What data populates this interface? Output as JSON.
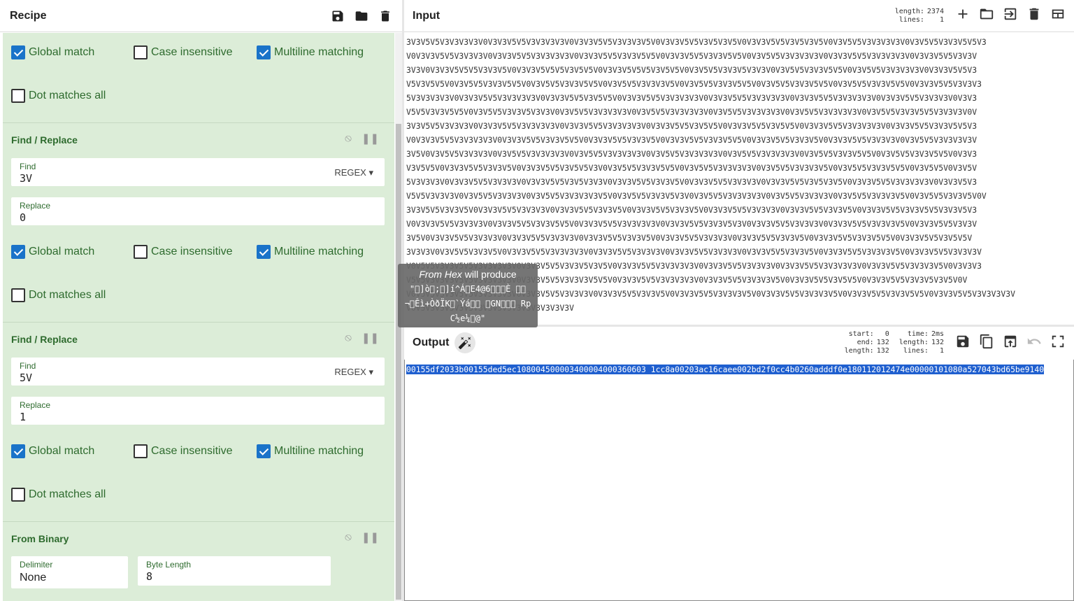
{
  "recipe": {
    "title": "Recipe",
    "header_icons": [
      "save-icon",
      "folder-icon",
      "trash-icon"
    ],
    "top_options": {
      "global_match": "Global match",
      "case_insensitive": "Case insensitive",
      "multiline": "Multiline matching",
      "dot_all": "Dot matches all"
    },
    "ops": [
      {
        "title": "Find / Replace",
        "find_label": "Find",
        "find_value": "3V",
        "find_mode": "REGEX",
        "replace_label": "Replace",
        "replace_value": "0",
        "global_match": "Global match",
        "case_insensitive": "Case insensitive",
        "multiline": "Multiline matching",
        "dot_all": "Dot matches all"
      },
      {
        "title": "Find / Replace",
        "find_label": "Find",
        "find_value": "5V",
        "find_mode": "REGEX",
        "replace_label": "Replace",
        "replace_value": "1",
        "global_match": "Global match",
        "case_insensitive": "Case insensitive",
        "multiline": "Multiline matching",
        "dot_all": "Dot matches all"
      },
      {
        "title": "From Binary",
        "delimiter_label": "Delimiter",
        "delimiter_value": "None",
        "byte_length_label": "Byte Length",
        "byte_length_value": "8"
      }
    ]
  },
  "input": {
    "title": "Input",
    "stats": {
      "length_label": "length:",
      "length": "2374",
      "lines_label": "lines:",
      "lines": "1"
    },
    "lines": [
      "3V3V5V5V3V3V3V3V0V3V3V5V5V3V3V3V3V0V3V3V5V5V3V3V3V5V0V3V3V5V5V3V5V3V5V0V3V3V5V5V3V5V3V5V0V3V5V5V3V3V3V3V0V3V5V5V3V3V5V5V3",
      "V0V3V3V5V5V3V3V3V0V3V3V5V5V3V3V3V3V0V3V3V5V5V3V3V5V5V0V3V3V5V5V3V3V5V5V0V3V5V5V3V3V3V3V0V3V3V5V5V3V3V3V3V0V3V3V5V5V3V3V",
      "3V3V0V3V3V5V5V5V3V3V5V0V3V3V5V5V5V3V5V5V0V3V3V5V5V5V3V5V5V0V3V5V5V3V3V5V3V3V0V3V5V5V3V3V5V5V0V3V5V5V3V3V3V3V0V3V3V5V5V3",
      "V5V3V5V5V0V3V5V5V3V3V5V5V0V3V5V5V3V3V5V5V0V3V5V5V3V3V3V5V0V3V5V5V3V3V5V5V0V3V5V5V3V3V5V5V0V3V5V5V3V3V5V5V0V3V3V5V5V3V3V3",
      "5V3V3V3V3V0V3V3V5V5V3V3V3V3V0V3V3V5V5V3V5V5V0V3V3V5V5V3V3V3V3V0V3V3V5V5V3V3V3V3V0V3V3V5V5V3V3V3V3V0V3V3V5V5V3V3V3V0V3V3",
      "V5V5V3V3V5V5V0V3V5V5V3V3V5V3V3V0V3V5V5V3V3V3V3V0V3V5V5V3V3V3V3V0V3V5V5V3V3V3V3V0V3V5V5V3V3V3V3V0V3V5V5V3V3V5V5V3V3V3V0V",
      "3V3V5V5V3V3V3V0V3V3V5V5V3V3V3V3V0V3V3V5V5V3V3V3V3V0V3V3V5V5V3V5V5V0V3V3V5V5V3V5V5V0V3V3V5V5V3V3V3V3V0V3V3V5V5V3V3V5V5V3",
      "V0V3V3V5V5V3V3V3V3V0V3V3V5V5V3V3V5V5V0V3V3V5V5V3V3V5V0V3V3V5V5V3V3V5V5V0V3V3V5V5V3V3V5V0V3V3V5V5V3V3V3V0V3V5V5V3V3V3V3V",
      "3V5V0V3V5V5V3V3V3V0V3V5V5V3V3V3V3V0V3V5V5V3V3V3V3V0V3V5V5V3V3V3V3V0V3V5V5V3V3V3V3V0V3V5V5V3V3V5V5V0V3V5V5V3V3V5V5V0V3V3",
      "V3V5V5V0V3V3V5V5V3V3V5V0V3V3V5V5V3V5V5V3V0V3V5V5V3V3V5V5V0V3V5V5V3V3V3V3V0V3V5V5V3V3V3V5V0V3V5V5V3V3V5V5V0V3V5V5V0V3V5V",
      "5V3V3V3V0V3V3V5V5V3V3V3V0V3V3V5V5V3V5V3V3V0V3V3V5V5V3V3V5V0V3V3V5V5V3V3V3V0V3V3V5V5V3V5V3V5V0V3V3V5V5V3V3V3V3V0V3V3V5V3",
      "V5V5V3V3V3V0V3V5V5V3V3V3V0V3V5V5V3V3V3V3V5V0V3V5V5V3V3V5V3V0V3V5V5V3V3V3V3V0V3V5V5V3V3V3V0V3V5V5V3V3V3V5V0V3V5V5V3V3V5V0V",
      "3V3V5V5V3V3V5V0V3V3V5V5V3V3V3V0V3V3V5V5V3V3V5V0V3V3V5V5V3V3V5V0V3V3V5V5V3V3V3V0V3V3V5V5V3V3V5V0V3V3V5V5V3V3V5V5V3V3V5V3",
      "V0V3V3V5V5V3V3V3V0V3V3V5V5V3V3V5V5V0V3V3V5V5V3V3V3V3V0V3V3V5V5V3V3V5V3V0V3V3V5V5V3V3V3V0V3V3V5V5V3V3V3V5V0V3V3V5V5V3V3V",
      "3V5V0V3V3V5V5V3V3V3V0V3V3V5V5V3V3V3V0V3V3V5V5V3V3V5V0V3V3V5V5V3V3V3V0V3V3V5V5V3V3V5V0V3V3V5V5V3V3V5V5V0V3V3V5V5V3V5V5V",
      "3V3V3V0V3V5V5V3V3V5V0V3V3V5V5V3V3V3V3V0V3V3V5V5V3V3V3V0V3V3V5V5V3V3V3V0V3V3V5V5V3V3V5V0V3V3V5V5V3V3V3V5V0V3V3V5V5V3V3V3V",
      "V0V5V5V3V3V5V5V3V3V3V3V0V3V3V5V5V3V3V5V3V5V0V3V3V5V5V3V3V3V3V0V3V3V5V5V3V3V3V0V3V3V5V5V3V3V3V3V0V3V3V5V5V3V3V3V5V0V3V3V3",
      "V5V5V3V3V3V5V5V3V3V3V3V0V3V3V5V5V3V3V3V5V5V0V3V3V5V5V3V3V3V3V0V3V3V5V5V3V3V3V5V0V3V3V5V5V3V5V5V0V3V3V5V5V3V3V5V3V5V0V",
      "V0V5V5V3V3V5V5V3V3V3V3V0V3V3V5V5V3V3V3V0V3V3V5V5V3V3V5V0V3V3V5V5V3V3V3V5V0V3V3V5V5V3V3V3V5V0V3V3V5V5V3V3V5V5V0V3V3V5V5V3V3V3V3V",
      "V0V5V3V5V5V3V3V3V3V5V5V3V3V3V3V3V3V"
    ]
  },
  "tooltip": {
    "op_name": "From Hex",
    "suffix": " will produce",
    "preview": "\"\u0000]ò\u0000;\u0000]í^Á\u0000E4@6\u0000\u0000\u0000È \u0000\u0000 ¬\u0000Êì+ÒðÏK\u0000`Ýá\u0000\u0000 \u0000GN\u0000\u0000\u0000 RpC½e¼\u0000@\""
  },
  "output": {
    "title": "Output",
    "stats": {
      "start_label": "start:",
      "start": "0",
      "end_label": "end:",
      "end": "132",
      "length_label": "length:",
      "length": "132",
      "time_label": "time:",
      "time": "2ms",
      "olength_label": "length:",
      "olength": "132",
      "lines_label": "lines:",
      "lines": "1"
    },
    "text": "00155df2033b00155ded5ec108004500003400004000360603 1cc8a00203ac16caee002bd2f0cc4b0260adddf0e180112012474e00000101080a527043bd65be9140"
  }
}
